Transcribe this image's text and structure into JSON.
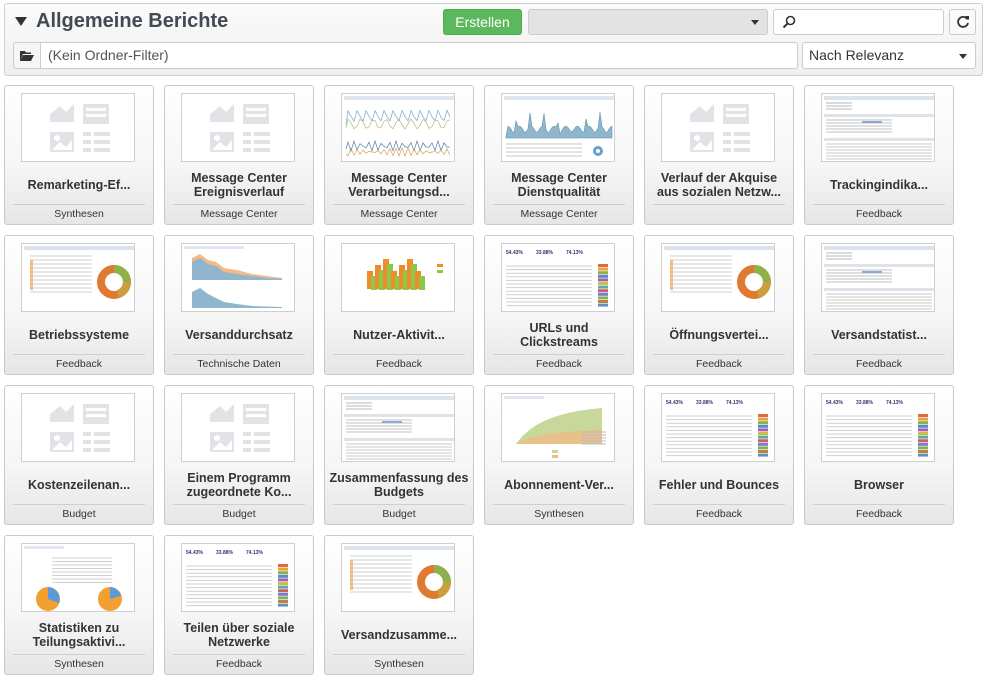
{
  "header": {
    "title": "Allgemeine Berichte",
    "create_label": "Erstellen",
    "dropdown_value": "",
    "search_placeholder": "",
    "folder_filter": "(Kein Ordner-Filter)",
    "sort_value": "Nach Relevanz",
    "refresh_icon": "refresh-icon",
    "folder_icon": "folder-open-icon",
    "search_icon": "magnifier-icon"
  },
  "colors": {
    "create_button": "#5cb85c",
    "title": "#434a54"
  },
  "reports": [
    {
      "name": "Remarketing-Ef...",
      "category": "Synthesen",
      "thumb": "placeholder"
    },
    {
      "name": "Message Center Ereignisverlauf",
      "category": "Message Center",
      "thumb": "placeholder"
    },
    {
      "name": "Message Center Verarbeitungsd...",
      "category": "Message Center",
      "thumb": "multi-line"
    },
    {
      "name": "Message Center Dienstqualität",
      "category": "Message Center",
      "thumb": "area-spikes"
    },
    {
      "name": "Verlauf der Akquise aus sozialen Netzw...",
      "category": "",
      "thumb": "placeholder"
    },
    {
      "name": "Trackingindika...",
      "category": "Feedback",
      "thumb": "table"
    },
    {
      "name": "Betriebssysteme",
      "category": "Feedback",
      "thumb": "donut-table"
    },
    {
      "name": "Versanddurchsatz",
      "category": "Technische Daten",
      "thumb": "area-two"
    },
    {
      "name": "Nutzer-Aktivit...",
      "category": "Feedback",
      "thumb": "bars-3d"
    },
    {
      "name": "URLs und Clickstreams",
      "category": "Feedback",
      "thumb": "stats-table"
    },
    {
      "name": "Öffnungsvertei...",
      "category": "Feedback",
      "thumb": "donut-table"
    },
    {
      "name": "Versandstatist...",
      "category": "Feedback",
      "thumb": "table"
    },
    {
      "name": "Kostenzeilenan...",
      "category": "Budget",
      "thumb": "placeholder"
    },
    {
      "name": "Einem Programm zugeordnete Ko...",
      "category": "Budget",
      "thumb": "placeholder"
    },
    {
      "name": "Zusammenfassung des Budgets",
      "category": "Budget",
      "thumb": "table"
    },
    {
      "name": "Abonnement-Ver...",
      "category": "Synthesen",
      "thumb": "area-growth"
    },
    {
      "name": "Fehler und Bounces",
      "category": "Feedback",
      "thumb": "stats-table"
    },
    {
      "name": "Browser",
      "category": "Feedback",
      "thumb": "stats-table"
    },
    {
      "name": "Statistiken zu Teilungsaktivi...",
      "category": "Synthesen",
      "thumb": "pies"
    },
    {
      "name": "Teilen über soziale Netzwerke",
      "category": "Feedback",
      "thumb": "stats-table"
    },
    {
      "name": "Versandzusamme...",
      "category": "Synthesen",
      "thumb": "donut-table"
    }
  ]
}
